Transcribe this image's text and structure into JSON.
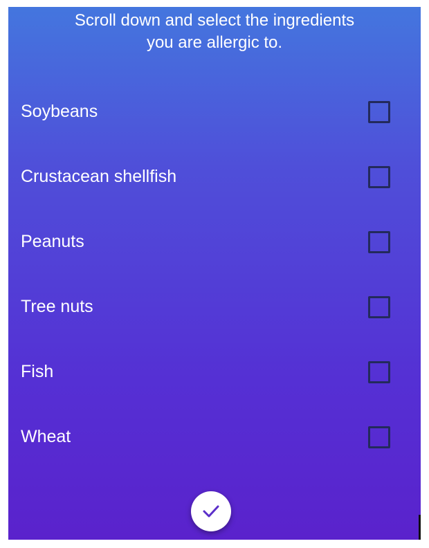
{
  "header": {
    "line1": "Scroll down and select the ingredients",
    "line2": "you are allergic to."
  },
  "allergens": [
    {
      "label": "Soybeans",
      "checked": false
    },
    {
      "label": "Crustacean shellfish",
      "checked": false
    },
    {
      "label": "Peanuts",
      "checked": false
    },
    {
      "label": "Tree nuts",
      "checked": false
    },
    {
      "label": "Fish",
      "checked": false
    },
    {
      "label": "Wheat",
      "checked": false
    }
  ],
  "confirm_button": {
    "icon": "check-icon"
  },
  "colors": {
    "gradient_top": "#4476de",
    "gradient_bottom": "#5a22cc",
    "text": "#ffffff",
    "checkbox_border": "#232a5c",
    "check_icon": "#5b2fc9"
  }
}
